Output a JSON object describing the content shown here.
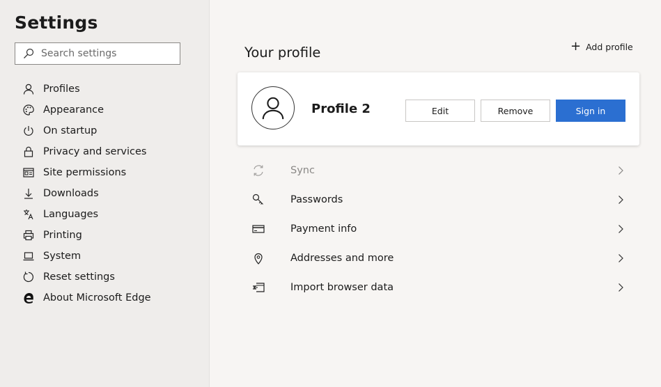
{
  "sidebar": {
    "title": "Settings",
    "search_placeholder": "Search settings",
    "items": [
      {
        "label": "Profiles",
        "icon": "person-icon"
      },
      {
        "label": "Appearance",
        "icon": "palette-icon"
      },
      {
        "label": "On startup",
        "icon": "power-icon"
      },
      {
        "label": "Privacy and services",
        "icon": "lock-icon"
      },
      {
        "label": "Site permissions",
        "icon": "site-permissions-icon"
      },
      {
        "label": "Downloads",
        "icon": "download-icon"
      },
      {
        "label": "Languages",
        "icon": "languages-icon"
      },
      {
        "label": "Printing",
        "icon": "printer-icon"
      },
      {
        "label": "System",
        "icon": "laptop-icon"
      },
      {
        "label": "Reset settings",
        "icon": "reset-icon"
      },
      {
        "label": "About Microsoft Edge",
        "icon": "edge-logo-icon"
      }
    ]
  },
  "main": {
    "heading": "Your profile",
    "add_profile_label": "Add profile",
    "profile": {
      "name": "Profile 2",
      "edit_label": "Edit",
      "remove_label": "Remove",
      "signin_label": "Sign in"
    },
    "list": [
      {
        "label": "Sync",
        "icon": "sync-icon",
        "disabled": true
      },
      {
        "label": "Passwords",
        "icon": "key-icon"
      },
      {
        "label": "Payment info",
        "icon": "credit-card-icon"
      },
      {
        "label": "Addresses and more",
        "icon": "location-pin-icon"
      },
      {
        "label": "Import browser data",
        "icon": "import-icon"
      }
    ]
  },
  "colors": {
    "accent": "#2b6fd1",
    "sidebar_bg": "#efedeb",
    "main_bg": "#f7f5f3"
  }
}
